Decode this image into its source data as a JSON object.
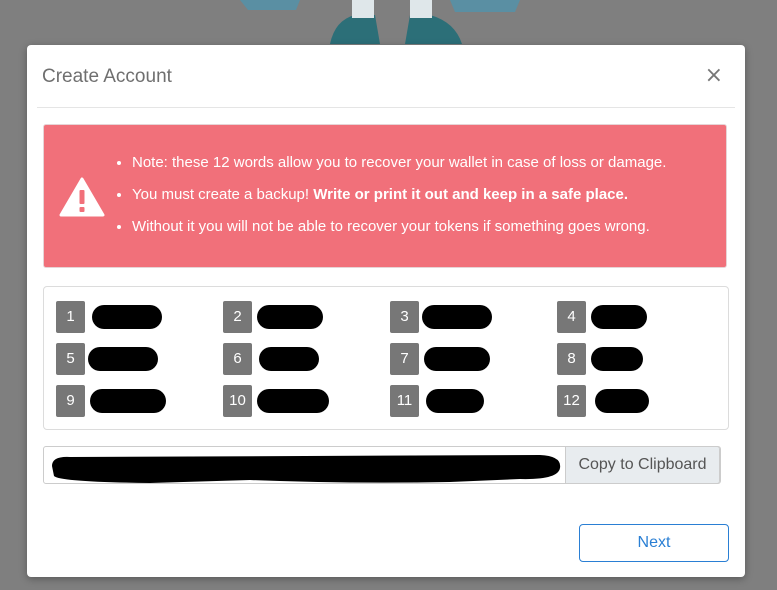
{
  "modal": {
    "title": "Create Account",
    "close_label": "×"
  },
  "alert": {
    "items": [
      "Note: these 12 words allow you to recover your wallet in case of loss or damage.",
      "You must create a backup! ",
      "Without it you will not be able to recover your tokens if something goes wrong."
    ],
    "bold_text": "Write or print it out and keep in a safe place."
  },
  "words": {
    "numbers": [
      "1",
      "2",
      "3",
      "4",
      "5",
      "6",
      "7",
      "8",
      "9",
      "10",
      "11",
      "12"
    ]
  },
  "clipboard": {
    "button_label": "Copy to Clipboard"
  },
  "footer": {
    "next_label": "Next"
  },
  "colors": {
    "alert_bg": "#f1707a",
    "accent": "#2a7fd4",
    "overlay": "#7f7f7f"
  }
}
